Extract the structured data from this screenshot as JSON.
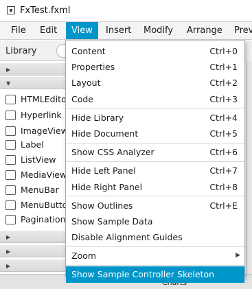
{
  "window": {
    "title": "FxTest.fxml"
  },
  "menubar": {
    "items": [
      {
        "label": "File"
      },
      {
        "label": "Edit"
      },
      {
        "label": "View"
      },
      {
        "label": "Insert"
      },
      {
        "label": "Modify"
      },
      {
        "label": "Arrange"
      },
      {
        "label": "Previ"
      }
    ],
    "active_index": 2
  },
  "library": {
    "title": "Library",
    "items": [
      {
        "label": "HTMLEditor",
        "icon": "html-editor-icon"
      },
      {
        "label": "Hyperlink",
        "icon": "hyperlink-icon"
      },
      {
        "label": "ImageView",
        "icon": "imageview-icon"
      },
      {
        "label": "Label",
        "icon": "label-icon"
      },
      {
        "label": "ListView",
        "icon": "listview-icon"
      },
      {
        "label": "MediaView",
        "icon": "mediaview-icon"
      },
      {
        "label": "MenuBar",
        "icon": "menubar-icon"
      },
      {
        "label": "MenuButton",
        "icon": "menubutton-icon"
      },
      {
        "label": "Pagination",
        "icon": "pagination-icon"
      }
    ]
  },
  "status": {
    "charts_label": "Charts"
  },
  "view_menu": {
    "content": {
      "label": "Content",
      "shortcut": "Ctrl+0"
    },
    "properties": {
      "label": "Properties",
      "shortcut": "Ctrl+1"
    },
    "layout": {
      "label": "Layout",
      "shortcut": "Ctrl+2"
    },
    "code": {
      "label": "Code",
      "shortcut": "Ctrl+3"
    },
    "hide_library": {
      "label": "Hide Library",
      "shortcut": "Ctrl+4"
    },
    "hide_document": {
      "label": "Hide Document",
      "shortcut": "Ctrl+5"
    },
    "show_css_analyzer": {
      "label": "Show CSS Analyzer",
      "shortcut": "Ctrl+6"
    },
    "hide_left_panel": {
      "label": "Hide Left Panel",
      "shortcut": "Ctrl+7"
    },
    "hide_right_panel": {
      "label": "Hide Right Panel",
      "shortcut": "Ctrl+8"
    },
    "show_outlines": {
      "label": "Show Outlines",
      "shortcut": "Ctrl+E"
    },
    "show_sample_data": {
      "label": "Show Sample Data"
    },
    "disable_alignment_guides": {
      "label": "Disable Alignment Guides"
    },
    "zoom": {
      "label": "Zoom"
    },
    "show_sample_controller_skeleton": {
      "label": "Show Sample Controller Skeleton"
    }
  },
  "colors": {
    "accent": "#0096c9"
  }
}
